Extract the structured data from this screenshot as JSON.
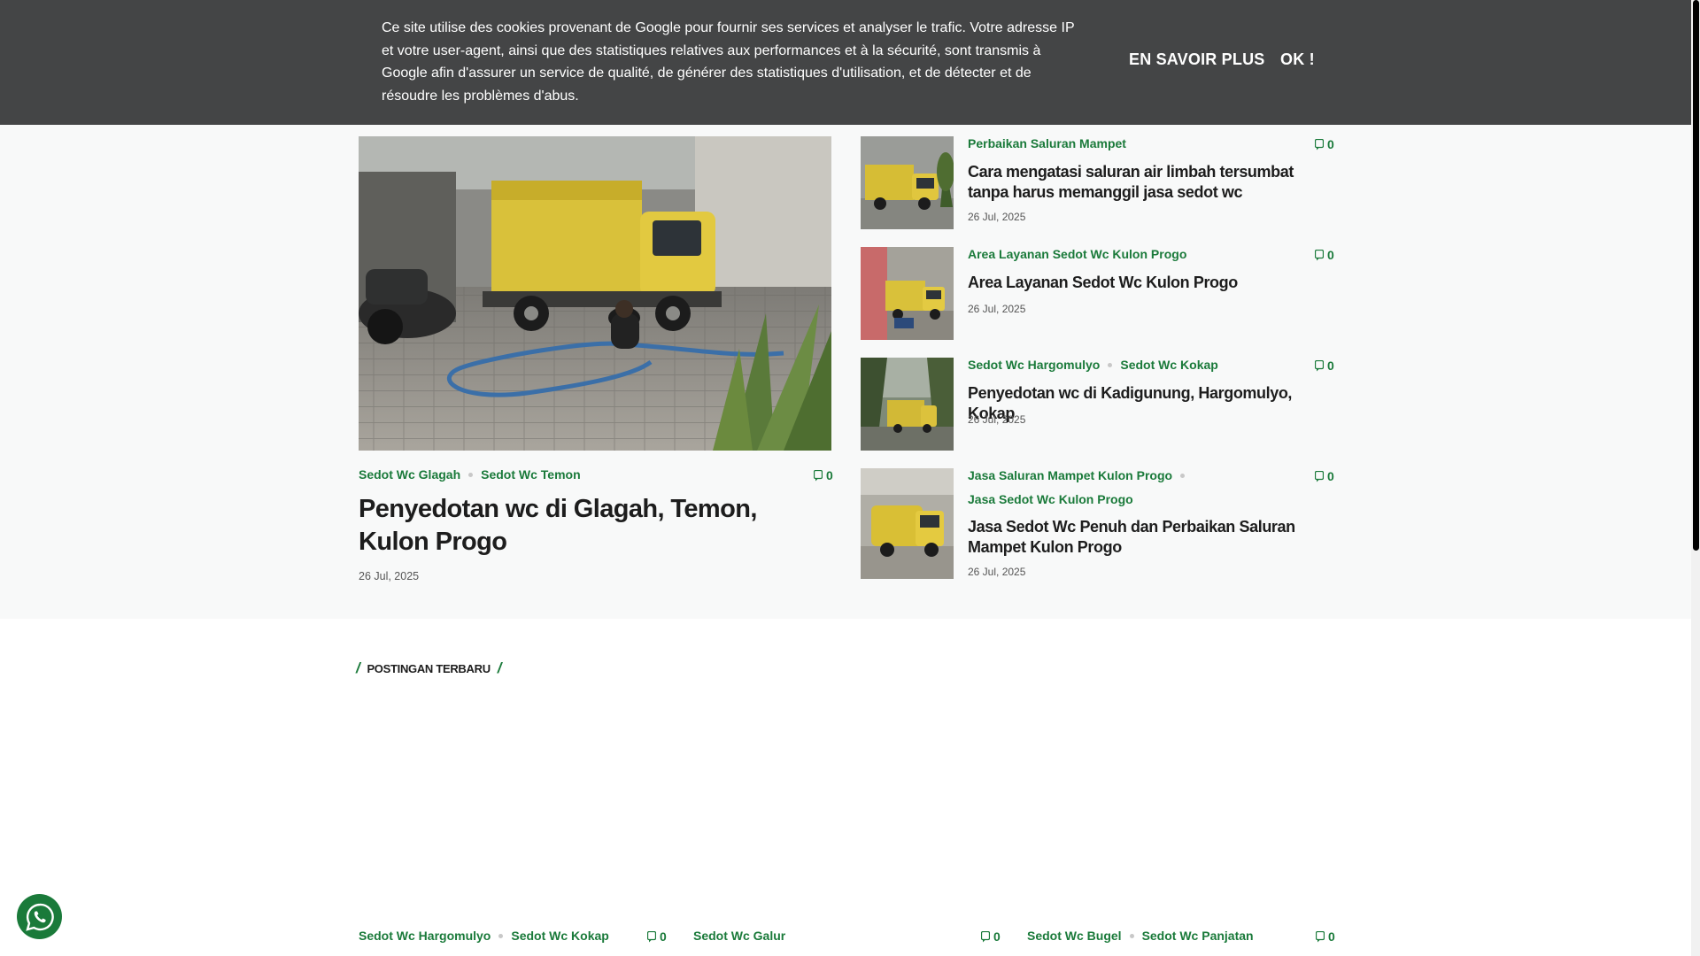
{
  "cookie": {
    "text": "Ce site utilise des cookies provenant de Google pour fournir ses services et analyser le trafic. Votre adresse IP et votre user-agent, ainsi que des statistiques relatives aux performances et à la sécurité, sont transmis à Google afin d'assurer un service de qualité, de générer des statistiques d'utilisation, et de détecter et de résoudre les problèmes d'abus.",
    "learn_more": "EN SAVOIR PLUS",
    "ok": "OK !"
  },
  "featured": {
    "categories": [
      "Sedot Wc Glagah",
      "Sedot Wc Temon"
    ],
    "comments": "0",
    "title": "Penyedotan wc di Glagah, Temon, Kulon Progo",
    "date": "26 Jul, 2025"
  },
  "side_posts": [
    {
      "categories": [
        "Perbaikan Saluran Mampet"
      ],
      "comments": "0",
      "title": "Cara mengatasi saluran air limbah tersumbat tanpa harus memanggil jasa sedot wc",
      "date": "26 Jul, 2025"
    },
    {
      "categories": [
        "Area Layanan Sedot Wc Kulon Progo"
      ],
      "comments": "0",
      "title": "Area Layanan Sedot Wc Kulon Progo",
      "date": "26 Jul, 2025"
    },
    {
      "categories": [
        "Sedot Wc Hargomulyo",
        "Sedot Wc Kokap"
      ],
      "comments": "0",
      "title": "Penyedotan wc di Kadigunung, Hargomulyo, Kokap",
      "date": "26 Jul, 2025"
    },
    {
      "categories": [
        "Jasa Saluran Mampet Kulon Progo",
        "Jasa Sedot Wc Kulon Progo"
      ],
      "comments": "0",
      "title": "Jasa Sedot Wc Penuh dan Perbaikan Saluran Mampet Kulon Progo",
      "date": "26 Jul, 2025"
    }
  ],
  "latest": {
    "heading": "POSTINGAN TERBARU",
    "posts": [
      {
        "categories": [
          "Sedot Wc Hargomulyo",
          "Sedot Wc Kokap"
        ],
        "comments": "0"
      },
      {
        "categories": [
          "Sedot Wc Galur"
        ],
        "comments": "0"
      },
      {
        "categories": [
          "Sedot Wc Bugel",
          "Sedot Wc Panjatan"
        ],
        "comments": "0"
      }
    ]
  },
  "colors": {
    "accent": "#1a7a3a",
    "cookie_bg": "#444546",
    "hero_bg": "#f8f9f9"
  },
  "icons": {
    "comment": "comment-icon",
    "whatsapp": "whatsapp-icon"
  }
}
